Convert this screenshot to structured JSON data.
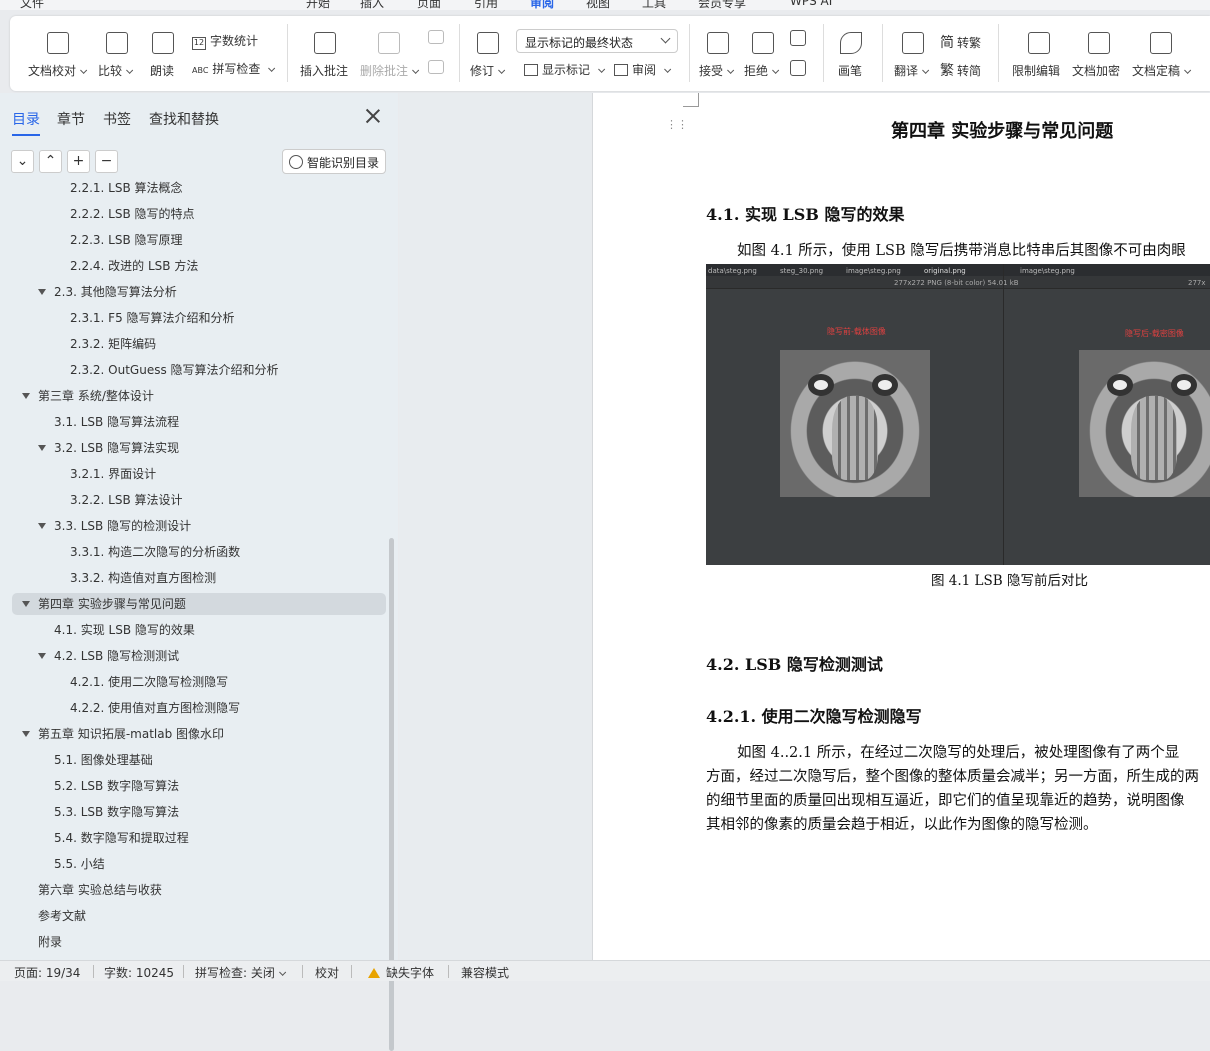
{
  "menu": {
    "items": [
      "文件",
      "开始",
      "插入",
      "页面",
      "引用",
      "审阅",
      "视图",
      "工具",
      "会员专享",
      "WPS AI"
    ],
    "active": "审阅"
  },
  "ribbon": {
    "proofread": "文档校对",
    "compare": "比较",
    "read_aloud": "朗读",
    "word_count": "字数统计",
    "spell_check": "拼写检查",
    "insert_comment": "插入批注",
    "delete_comment": "删除批注",
    "revise": "修订",
    "markup_state": "显示标记的最终状态",
    "show_markup": "显示标记",
    "review": "审阅",
    "accept": "接受",
    "reject": "拒绝",
    "pen": "画笔",
    "translate": "翻译",
    "to_trad": "转繁",
    "to_simp": "转简",
    "restrict_edit": "限制编辑",
    "encrypt": "文档加密",
    "finalize": "文档定稿"
  },
  "sidebar": {
    "tabs": [
      "目录",
      "章节",
      "书签",
      "查找和替换"
    ],
    "smart_button": "智能识别目录",
    "tree_buttons": [
      "⌄",
      "⌃",
      "+",
      "−"
    ],
    "toc": [
      {
        "text": "2.2.1. LSB 算法概念",
        "level": 3
      },
      {
        "text": "2.2.2. LSB 隐写的特点",
        "level": 3
      },
      {
        "text": "2.2.3. LSB 隐写原理",
        "level": 3
      },
      {
        "text": "2.2.4. 改进的 LSB 方法",
        "level": 3
      },
      {
        "text": "2.3. 其他隐写算法分析",
        "level": 2,
        "expand": true
      },
      {
        "text": "2.3.1. F5 隐写算法介绍和分析",
        "level": 3
      },
      {
        "text": "2.3.2. 矩阵编码",
        "level": 3
      },
      {
        "text": "2.3.2. OutGuess 隐写算法介绍和分析",
        "level": 3
      },
      {
        "text": "第三章 系统/整体设计",
        "level": 1,
        "expand": true
      },
      {
        "text": "3.1. LSB 隐写算法流程",
        "level": 2
      },
      {
        "text": "3.2. LSB 隐写算法实现",
        "level": 2,
        "expand": true
      },
      {
        "text": "3.2.1. 界面设计",
        "level": 3
      },
      {
        "text": "3.2.2. LSB 算法设计",
        "level": 3
      },
      {
        "text": "3.3. LSB 隐写的检测设计",
        "level": 2,
        "expand": true
      },
      {
        "text": "3.3.1. 构造二次隐写的分析函数",
        "level": 3
      },
      {
        "text": "3.3.2. 构造值对直方图检测",
        "level": 3
      },
      {
        "text": "第四章 实验步骤与常见问题",
        "level": 1,
        "expand": true,
        "selected": true
      },
      {
        "text": "4.1. 实现 LSB 隐写的效果",
        "level": 2
      },
      {
        "text": "4.2. LSB 隐写检测测试",
        "level": 2,
        "expand": true
      },
      {
        "text": "4.2.1. 使用二次隐写检测隐写",
        "level": 3
      },
      {
        "text": "4.2.2. 使用值对直方图检测隐写",
        "level": 3
      },
      {
        "text": "第五章 知识拓展-matlab 图像水印",
        "level": 1,
        "expand": true
      },
      {
        "text": "5.1. 图像处理基础",
        "level": 2
      },
      {
        "text": "5.2. LSB 数字隐写算法",
        "level": 2
      },
      {
        "text": "5.3. LSB 数字隐写算法",
        "level": 2
      },
      {
        "text": "5.4. 数字隐写和提取过程",
        "level": 2
      },
      {
        "text": "5.5. 小结",
        "level": 2
      },
      {
        "text": "第六章 实验总结与收获",
        "level": 1
      },
      {
        "text": "参考文献",
        "level": 1
      },
      {
        "text": "附录",
        "level": 1
      }
    ]
  },
  "document": {
    "chapter_title": "第四章  实验步骤与常见问题",
    "h41": "4.1.  实现 LSB 隐写的效果",
    "p41": "如图 4.1 所示，使用 LSB 隐写后携带消息比特串后其图像不可由肉眼",
    "figure": {
      "tabs": [
        "data\\steg.png",
        "steg_30.png",
        "image\\steg.png",
        "original.png",
        "image\\steg.png"
      ],
      "meta_left": "277x272 PNG (8-bit color) 54.01 kB",
      "meta_right": "277x",
      "label_left": "隐写前-载体图像",
      "label_right": "隐写后-载密图像"
    },
    "caption": "图 4.1 LSB 隐写前后对比",
    "h42": "4.2. LSB 隐写检测测试",
    "h421": "4.2.1.  使用二次隐写检测隐写",
    "p421": [
      "如图 4..2.1 所示，在经过二次隐写的处理后，被处理图像有了两个显",
      "方面，经过二次隐写后，整个图像的整体质量会减半；另一方面，所生成的两",
      "的细节里面的质量回出现相互逼近，即它们的值呈现靠近的趋势，说明图像",
      "其相邻的像素的质量会趋于相近，以此作为图像的隐写检测。"
    ]
  },
  "status": {
    "page": "页面: 19/34",
    "words": "字数: 10245",
    "spell": "拼写检查: 关闭",
    "proof": "校对",
    "missing_font": "缺失字体",
    "compat": "兼容模式"
  },
  "colors": {
    "accent": "#2966e8",
    "selected_row": "#d3d9de",
    "sidebar_bg": "#e8eef2"
  }
}
